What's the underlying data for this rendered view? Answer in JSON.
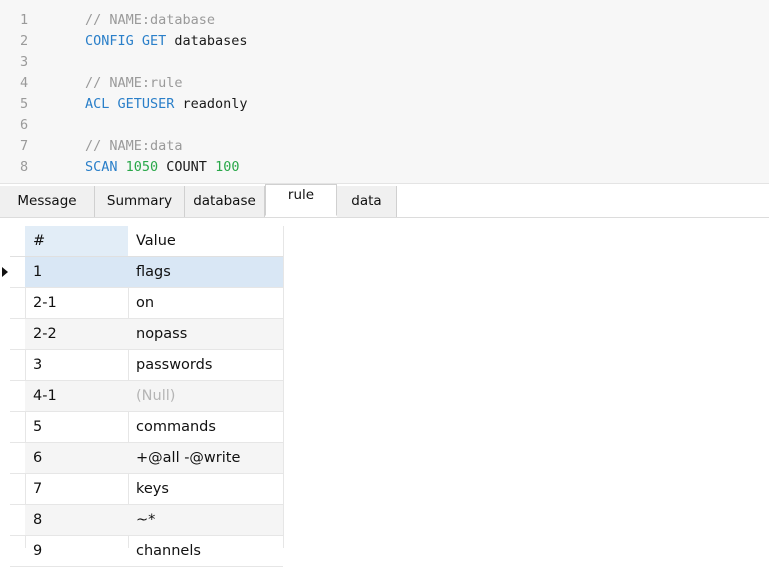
{
  "editor": {
    "lines": [
      {
        "n": "1",
        "tokens": [
          {
            "t": "// NAME:database",
            "k": "comment"
          }
        ]
      },
      {
        "n": "2",
        "tokens": [
          {
            "t": "CONFIG GET",
            "k": "kw"
          },
          {
            "t": " databases",
            "k": "plain"
          }
        ]
      },
      {
        "n": "3",
        "tokens": []
      },
      {
        "n": "4",
        "tokens": [
          {
            "t": "// NAME:rule",
            "k": "comment"
          }
        ]
      },
      {
        "n": "5",
        "tokens": [
          {
            "t": "ACL GETUSER",
            "k": "kw"
          },
          {
            "t": " readonly",
            "k": "plain"
          }
        ]
      },
      {
        "n": "6",
        "tokens": []
      },
      {
        "n": "7",
        "tokens": [
          {
            "t": "// NAME:data",
            "k": "comment"
          }
        ]
      },
      {
        "n": "8",
        "tokens": [
          {
            "t": "SCAN",
            "k": "kw"
          },
          {
            "t": " 1050",
            "k": "num"
          },
          {
            "t": " COUNT",
            "k": "plain"
          },
          {
            "t": " 100",
            "k": "num"
          }
        ]
      }
    ]
  },
  "tabs": [
    {
      "label": "Message",
      "active": false
    },
    {
      "label": "Summary",
      "active": false
    },
    {
      "label": "database",
      "active": false
    },
    {
      "label": "rule",
      "active": true
    },
    {
      "label": "data",
      "active": false
    }
  ],
  "grid": {
    "headers": {
      "num": "#",
      "value": "Value"
    },
    "rows": [
      {
        "num": "1",
        "value": "flags",
        "selected": true
      },
      {
        "num": "2-1",
        "value": "on"
      },
      {
        "num": "2-2",
        "value": "nopass"
      },
      {
        "num": "3",
        "value": "passwords"
      },
      {
        "num": "4-1",
        "value": "(Null)",
        "null": true
      },
      {
        "num": "5",
        "value": "commands"
      },
      {
        "num": "6",
        "value": "+@all -@write"
      },
      {
        "num": "7",
        "value": "keys"
      },
      {
        "num": "8",
        "value": "~*"
      },
      {
        "num": "9",
        "value": "channels"
      }
    ]
  },
  "colors": {
    "keyword": "#2a7fc9",
    "number": "#2aa84a",
    "comment": "#9a9a9a",
    "selected_row": "#d9e7f5"
  }
}
